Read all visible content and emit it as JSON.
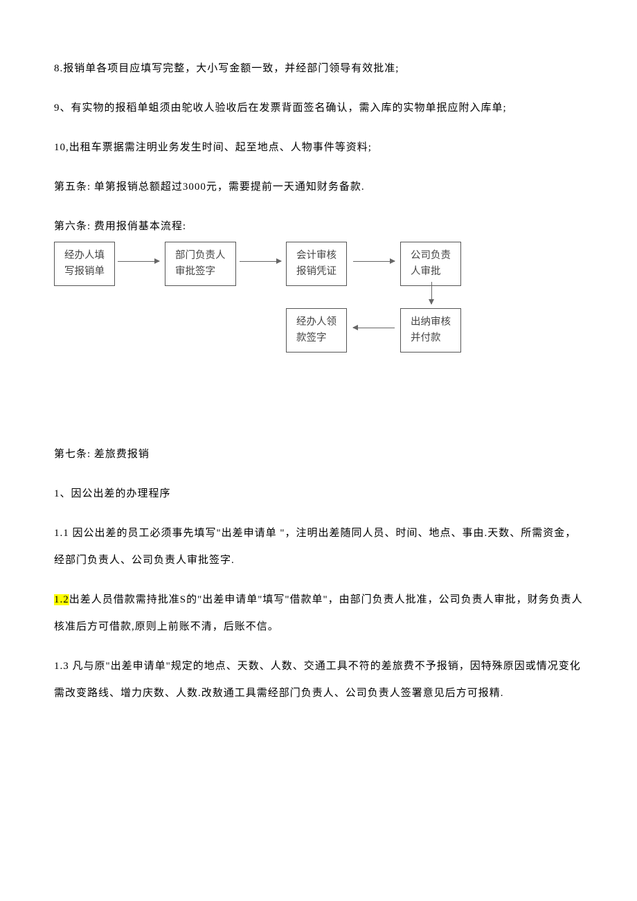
{
  "paragraphs": {
    "p8": "8.报销单各项目应填写完整，大小写金额一致，并经部门领导有效批准;",
    "p9": "9、有实物的报稻单蛆须由鸵收人验收后在发票背面签名确认，需入库的实物单抿应附入库单;",
    "p10": "10,出租车票据需注明业务发生时间、起至地点、人物事件等资料;",
    "article5": "第五条:  单第报销总额超过3000元，需要提前一天通知财务备款.",
    "article6_title": "第六条:  费用报俏基本流程:",
    "article7_title": "第七条:  差旅费报销",
    "section1_title": "1、因公出差的办理程序",
    "p1_1": "1.1  因公出差的员工必须事先填写\"出差申请单 \"，注明出差随同人员、时间、地点、事由.天数、所需资金，经部门负责人、公司负责人审批签字.",
    "p1_2_prefix": "1.2",
    "p1_2_body": "出差人员借款需持批准S的\"出差申请单\"填写\"借款单\"，由部门负责人批准，公司负责人审批，财务负责人核准后方可借款,原则上前账不清，后账不信。",
    "p1_3": "1.3  凡与原\"出差申请单\"规定的地点、天数、人数、交通工具不符的差旅费不予报销，因特殊原因或情况变化需改变路线、增力庆数、人数.改敖通工具需经部门负责人、公司负责人签署意见后方可报精."
  },
  "flowchart": {
    "box1_line1": "经办人填",
    "box1_line2": "写报销单",
    "box2_line1": "部门负责人",
    "box2_line2": "审批签字",
    "box3_line1": "会计审核",
    "box3_line2": "报销凭证",
    "box4_line1": "公司负责",
    "box4_line2": "人审批",
    "box5_line1": "出纳审核",
    "box5_line2": "并付款",
    "box6_line1": "经办人领",
    "box6_line2": "款签字"
  }
}
